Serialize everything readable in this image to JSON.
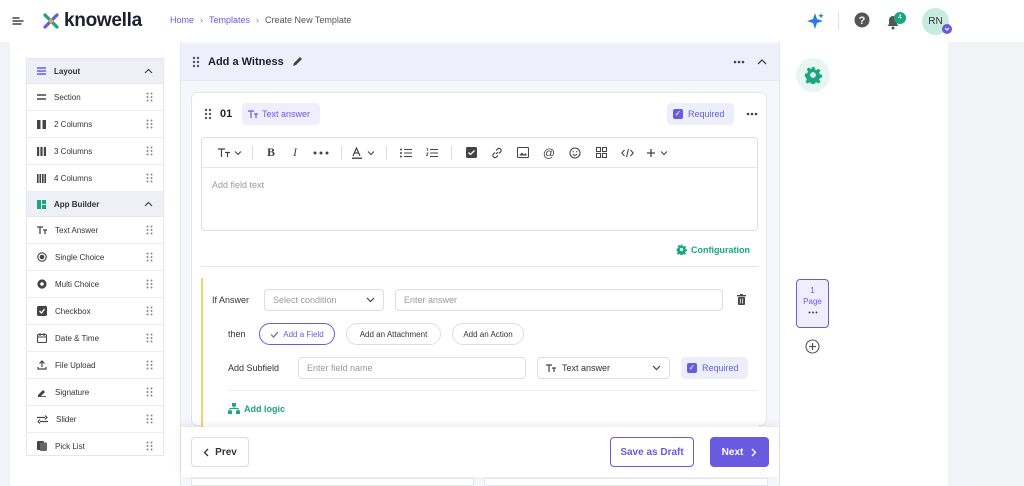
{
  "header": {
    "logo_text": "knowella",
    "breadcrumb": [
      {
        "label": "Home"
      },
      {
        "label": "Templates"
      },
      {
        "label": "Create New Template"
      }
    ],
    "notification_count": "4",
    "avatar_initials": "RN"
  },
  "sidebar": {
    "sections": [
      {
        "title": "Layout",
        "items": [
          "Section",
          "2 Columns",
          "3 Columns",
          "4 Columns"
        ]
      },
      {
        "title": "App Builder",
        "items": [
          "Text Answer",
          "Single Choice",
          "Multi Choice",
          "Checkbox",
          "Date & Time",
          "File Upload",
          "Signature",
          "Slider",
          "Pick List"
        ]
      }
    ]
  },
  "section": {
    "title": "Add a Witness"
  },
  "field": {
    "number": "01",
    "type_label": "Text answer",
    "required_label": "Required",
    "editor_placeholder": "Add field text",
    "configuration_label": "Configuration"
  },
  "logic": {
    "if_label": "If Answer",
    "condition_placeholder": "Select condition",
    "answer_placeholder": "Enter answer",
    "then_label": "then",
    "actions": [
      "Add a Field",
      "Add an Attachment",
      "Add an Action"
    ],
    "subfield_label": "Add Subfield",
    "subfield_placeholder": "Enter field name",
    "subfield_type": "Text answer",
    "required_label": "Required",
    "add_logic_label": "Add logic"
  },
  "footer": {
    "prev_label": "Prev",
    "draft_label": "Save as Draft",
    "next_label": "Next"
  },
  "page_panel": {
    "page_number": "1",
    "page_label": "Page"
  },
  "colors": {
    "brand": "#6a5ae0",
    "accent_green": "#18a77e",
    "logic_border": "#f1d36a"
  }
}
